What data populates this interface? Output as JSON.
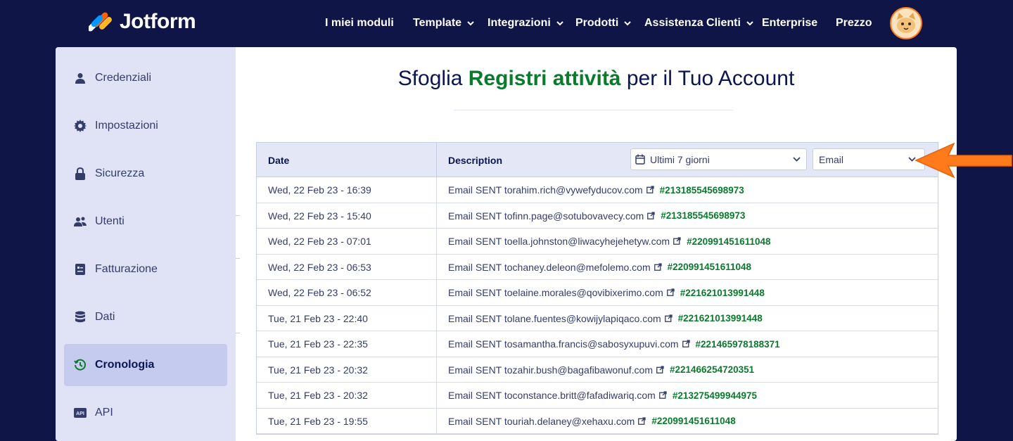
{
  "brand": {
    "name": "Jotform"
  },
  "nav": [
    {
      "label": "I miei moduli",
      "dropdown": false
    },
    {
      "label": "Template",
      "dropdown": true
    },
    {
      "label": "Integrazioni",
      "dropdown": true
    },
    {
      "label": "Prodotti",
      "dropdown": true
    },
    {
      "label": "Assistenza Clienti",
      "dropdown": true
    },
    {
      "label": "Enterprise",
      "dropdown": false
    },
    {
      "label": "Prezzo",
      "dropdown": false
    }
  ],
  "sidebar": {
    "items": [
      {
        "label": "Credenziali",
        "icon": "user-icon",
        "active": false
      },
      {
        "label": "Impostazioni",
        "icon": "gear-icon",
        "active": false
      },
      {
        "label": "Sicurezza",
        "icon": "lock-icon",
        "active": false
      },
      {
        "label": "Utenti",
        "icon": "users-icon",
        "active": false
      },
      {
        "label": "Fatturazione",
        "icon": "invoice-icon",
        "active": false
      },
      {
        "label": "Dati",
        "icon": "database-icon",
        "active": false
      },
      {
        "label": "Cronologia",
        "icon": "history-icon",
        "active": true
      },
      {
        "label": "API",
        "icon": "api-icon",
        "active": false
      }
    ]
  },
  "page": {
    "title_pre": "Sfoglia ",
    "title_highlight": "Registri attività",
    "title_post": " per il Tuo Account"
  },
  "table": {
    "col_date": "Date",
    "col_description": "Description",
    "range_filter": "Ultimi 7 giorni",
    "type_filter": "Email",
    "rows": [
      {
        "date": "Wed, 22 Feb 23 - 16:39",
        "prefix": "Email SENT to ",
        "email": "rahim.rich@vywefyducov.com",
        "form_id": "#213185545698973"
      },
      {
        "date": "Wed, 22 Feb 23 - 15:40",
        "prefix": "Email SENT to ",
        "email": "finn.page@sotubovavecy.com",
        "form_id": "#213185545698973"
      },
      {
        "date": "Wed, 22 Feb 23 - 07:01",
        "prefix": "Email SENT to ",
        "email": "ella.johnston@liwacyhejehetyw.com",
        "form_id": "#220991451611048"
      },
      {
        "date": "Wed, 22 Feb 23 - 06:53",
        "prefix": "Email SENT to ",
        "email": "chaney.deleon@mefolemo.com",
        "form_id": "#220991451611048"
      },
      {
        "date": "Wed, 22 Feb 23 - 06:52",
        "prefix": "Email SENT to ",
        "email": "elaine.morales@qovibixerimo.com",
        "form_id": "#221621013991448"
      },
      {
        "date": "Tue, 21 Feb 23 - 22:40",
        "prefix": "Email SENT to ",
        "email": "lane.fuentes@kowijylapiqaco.com",
        "form_id": "#221621013991448"
      },
      {
        "date": "Tue, 21 Feb 23 - 22:35",
        "prefix": "Email SENT to ",
        "email": "samantha.francis@sabosyxupuvi.com",
        "form_id": "#221465978188371"
      },
      {
        "date": "Tue, 21 Feb 23 - 20:32",
        "prefix": "Email SENT to ",
        "email": "zahir.bush@bagafibawonuf.com",
        "form_id": "#221466254720351"
      },
      {
        "date": "Tue, 21 Feb 23 - 20:32",
        "prefix": "Email SENT to ",
        "email": "constance.britt@fafadiwariq.com",
        "form_id": "#213275499944975"
      },
      {
        "date": "Tue, 21 Feb 23 - 19:55",
        "prefix": "Email SENT to ",
        "email": "uriah.delaney@xehaxu.com",
        "form_id": "#220991451611048"
      }
    ]
  },
  "colors": {
    "navy": "#0f1547",
    "accent_green": "#0a7a2c",
    "arrow": "#ff7a1a"
  }
}
